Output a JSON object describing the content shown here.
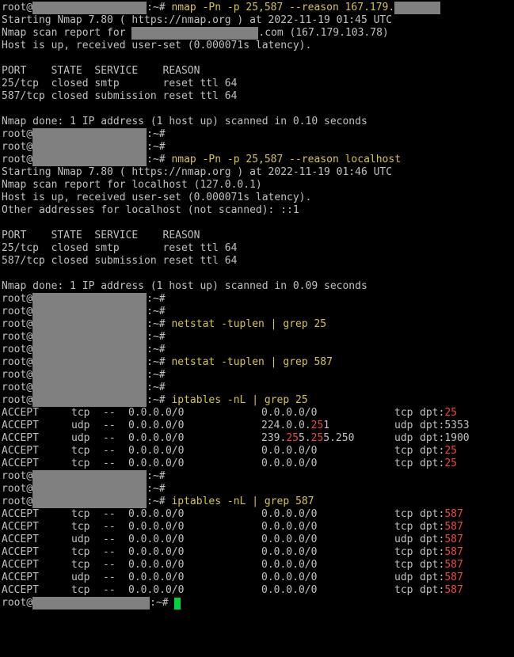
{
  "terminal": {
    "user": "root@",
    "prompt_suffix": ":~# ",
    "commands": {
      "nmap_remote": "nmap -Pn -p 25,587 --reason 167.179.",
      "nmap_localhost": "nmap -Pn -p 25,587 --reason localhost",
      "netstat_25": "netstat -tuplen | grep 25",
      "netstat_587": "netstat -tuplen | grep 587",
      "iptables_25": "iptables -nL | grep 25",
      "iptables_587": "iptables -nL | grep 587"
    },
    "scan1": {
      "starting": "Starting Nmap 7.80 ( https://nmap.org ) at 2022-11-19 01:45 UTC",
      "report_prefix": "Nmap scan report for ",
      "report_suffix": ".com (167.179.103.78)",
      "host_up": "Host is up, received user-set (0.000071s latency).",
      "header": "PORT    STATE  SERVICE    REASON",
      "rows": [
        "25/tcp  closed smtp       reset ttl 64",
        "587/tcp closed submission reset ttl 64"
      ],
      "done": "Nmap done: 1 IP address (1 host up) scanned in 0.10 seconds"
    },
    "scan2": {
      "starting": "Starting Nmap 7.80 ( https://nmap.org ) at 2022-11-19 01:46 UTC",
      "report": "Nmap scan report for localhost (127.0.0.1)",
      "host_up": "Host is up, received user-set (0.000071s latency).",
      "other": "Other addresses for localhost (not scanned): ::1",
      "header": "PORT    STATE  SERVICE    REASON",
      "rows": [
        "25/tcp  closed smtp       reset ttl 64",
        "587/tcp closed submission reset ttl 64"
      ],
      "done": "Nmap done: 1 IP address (1 host up) scanned in 0.09 seconds"
    },
    "iptables25": [
      {
        "target": "ACCEPT",
        "prot": "tcp",
        "opt": "--",
        "source": "0.0.0.0/0",
        "dest": "0.0.0.0/0",
        "proto": "tcp",
        "dpt": "25"
      },
      {
        "target": "ACCEPT",
        "prot": "udp",
        "opt": "--",
        "source": "0.0.0.0/0",
        "dest": "224.0.0.251",
        "proto": "udp",
        "dpt": "5353"
      },
      {
        "target": "ACCEPT",
        "prot": "udp",
        "opt": "--",
        "source": "0.0.0.0/0",
        "dest": "239.255.255.250",
        "proto": "udp",
        "dpt": "1900"
      },
      {
        "target": "ACCEPT",
        "prot": "tcp",
        "opt": "--",
        "source": "0.0.0.0/0",
        "dest": "0.0.0.0/0",
        "proto": "tcp",
        "dpt": "25"
      },
      {
        "target": "ACCEPT",
        "prot": "tcp",
        "opt": "--",
        "source": "0.0.0.0/0",
        "dest": "0.0.0.0/0",
        "proto": "tcp",
        "dpt": "25"
      }
    ],
    "iptables587": [
      {
        "target": "ACCEPT",
        "prot": "tcp",
        "opt": "--",
        "source": "0.0.0.0/0",
        "dest": "0.0.0.0/0",
        "proto": "tcp",
        "dpt": "587"
      },
      {
        "target": "ACCEPT",
        "prot": "tcp",
        "opt": "--",
        "source": "0.0.0.0/0",
        "dest": "0.0.0.0/0",
        "proto": "tcp",
        "dpt": "587"
      },
      {
        "target": "ACCEPT",
        "prot": "udp",
        "opt": "--",
        "source": "0.0.0.0/0",
        "dest": "0.0.0.0/0",
        "proto": "udp",
        "dpt": "587"
      },
      {
        "target": "ACCEPT",
        "prot": "tcp",
        "opt": "--",
        "source": "0.0.0.0/0",
        "dest": "0.0.0.0/0",
        "proto": "tcp",
        "dpt": "587"
      },
      {
        "target": "ACCEPT",
        "prot": "tcp",
        "opt": "--",
        "source": "0.0.0.0/0",
        "dest": "0.0.0.0/0",
        "proto": "tcp",
        "dpt": "587"
      },
      {
        "target": "ACCEPT",
        "prot": "udp",
        "opt": "--",
        "source": "0.0.0.0/0",
        "dest": "0.0.0.0/0",
        "proto": "udp",
        "dpt": "587"
      },
      {
        "target": "ACCEPT",
        "prot": "tcp",
        "opt": "--",
        "source": "0.0.0.0/0",
        "dest": "0.0.0.0/0",
        "proto": "tcp",
        "dpt": "587"
      }
    ],
    "colors": {
      "background": "#000000",
      "text": "#c0c0c0",
      "command": "#d7c34b",
      "highlight": "#ef4444",
      "redaction": "#808080",
      "cursor": "#00d23c"
    }
  }
}
